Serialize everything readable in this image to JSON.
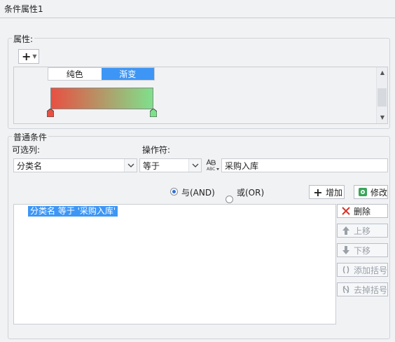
{
  "window": {
    "title": "条件属性1"
  },
  "attributes": {
    "group_title": "属性:",
    "add_icon": "plus-icon",
    "tabs": [
      {
        "label": "纯色",
        "active": false
      },
      {
        "label": "渐变",
        "active": true
      }
    ],
    "gradient": {
      "start_color": "#e85042",
      "end_color": "#7fe08c"
    }
  },
  "conditions": {
    "group_title": "普通条件",
    "column_label": "可选列:",
    "column_value": "分类名",
    "operator_label": "操作符:",
    "operator_value": "等于",
    "value_type_icon": "abc-text-icon",
    "value_text": "采购入库",
    "logic": [
      {
        "label": "与(AND)",
        "selected": true
      },
      {
        "label": "或(OR)",
        "selected": false
      }
    ],
    "add_button": "增加",
    "modify_button": "修改",
    "list_items": [
      "分类名 等于 '采购入库'"
    ],
    "side_buttons": [
      {
        "label": "删除",
        "icon": "delete-x-icon",
        "enabled": true
      },
      {
        "label": "上移",
        "icon": "arrow-up-icon",
        "enabled": false
      },
      {
        "label": "下移",
        "icon": "arrow-down-icon",
        "enabled": false
      },
      {
        "label": "添加括号",
        "icon": "add-bracket-icon",
        "enabled": false
      },
      {
        "label": "去掉括号",
        "icon": "remove-bracket-icon",
        "enabled": false
      }
    ]
  },
  "colors": {
    "accent": "#3d96f5",
    "delete_red": "#d9342b",
    "modify_green": "#3aa55a"
  }
}
